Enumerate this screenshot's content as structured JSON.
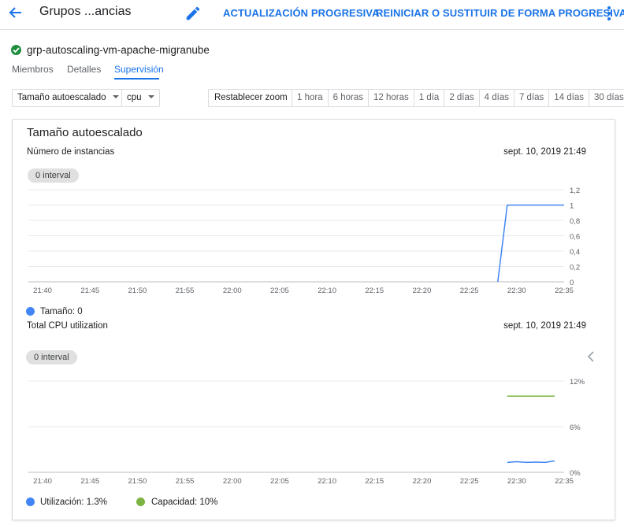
{
  "header": {
    "title": "Grupos ...ancias",
    "rolling_update": "ACTUALIZACIÓN PROGRESIVA",
    "rolling_restart": "REINICIAR O SUSTITUIR DE FORMA PROGRESIVA"
  },
  "group": {
    "name": "grp-autoscaling-vm-apache-migranube",
    "status": "ok"
  },
  "tabs": [
    {
      "label": "Miembros"
    },
    {
      "label": "Detalles"
    },
    {
      "label": "Supervisión",
      "active": true
    }
  ],
  "toolbar": {
    "chart_select": "Tamaño autoescalado",
    "metric_select": "cpu",
    "reset_zoom": "Restablecer zoom",
    "ranges": [
      "1 hora",
      "6 horas",
      "12 horas",
      "1 día",
      "2 días",
      "4 días",
      "7 días",
      "14 días",
      "30 días"
    ]
  },
  "card": {
    "title": "Tamaño autoescalado"
  },
  "colors": {
    "blue": "#4285f4",
    "green": "#7cb342",
    "accent": "#1a73e8"
  },
  "chart_data": [
    {
      "type": "line",
      "subtitle": "Número de instancias",
      "timestamp": "sept. 10, 2019 21:49",
      "interval": "0 interval",
      "x_ticks": [
        "21:40",
        "21:45",
        "21:50",
        "21:55",
        "22:00",
        "22:05",
        "22:10",
        "22:15",
        "22:20",
        "22:25",
        "22:30",
        "22:35"
      ],
      "y_ticks": [
        "0",
        "0,2",
        "0,4",
        "0,6",
        "0,8",
        "1",
        "1,2"
      ],
      "ylim": [
        0,
        1.2
      ],
      "grid": true,
      "series": [
        {
          "name": "Tamaño",
          "color": "#4285f4",
          "points": [
            [
              "22:28",
              0
            ],
            [
              "22:29",
              1
            ],
            [
              "22:35",
              1
            ]
          ]
        }
      ],
      "legend": [
        {
          "label": "Tamaño: 0",
          "color": "#4285f4"
        }
      ]
    },
    {
      "type": "line",
      "subtitle": "Total CPU utilization",
      "timestamp": "sept. 10, 2019 21:49",
      "interval": "0 interval",
      "x_ticks": [
        "21:40",
        "21:45",
        "21:50",
        "21:55",
        "22:00",
        "22:05",
        "22:10",
        "22:15",
        "22:20",
        "22:25",
        "22:30",
        "22:35"
      ],
      "y_ticks": [
        "0%",
        "6%",
        "12%"
      ],
      "ylim": [
        0,
        12
      ],
      "grid": true,
      "series": [
        {
          "name": "Capacidad",
          "color": "#7cb342",
          "points": [
            [
              "22:29",
              10
            ],
            [
              "22:34",
              10
            ]
          ]
        },
        {
          "name": "Utilización",
          "color": "#4285f4",
          "points": [
            [
              "22:29",
              1.3
            ],
            [
              "22:30",
              1.4
            ],
            [
              "22:31",
              1.3
            ],
            [
              "22:32",
              1.35
            ],
            [
              "22:33",
              1.3
            ],
            [
              "22:34",
              1.5
            ]
          ]
        }
      ],
      "legend": [
        {
          "label": "Utilización: 1.3%",
          "color": "#4285f4"
        },
        {
          "label": "Capacidad: 10%",
          "color": "#7cb342"
        }
      ]
    }
  ]
}
